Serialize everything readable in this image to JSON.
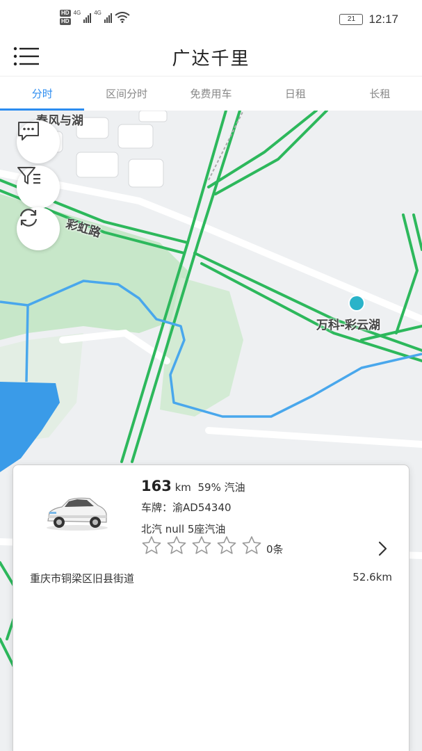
{
  "status_bar": {
    "hd1": "HD",
    "hd2": "HD",
    "net1": "4G",
    "net2": "4G",
    "battery": "21",
    "time": "12:17"
  },
  "header": {
    "title": "广达千里",
    "menu_icon": "hamburger-menu-icon"
  },
  "tabs": [
    {
      "label": "分时",
      "active": true
    },
    {
      "label": "区间分时",
      "active": false
    },
    {
      "label": "免费用车",
      "active": false
    },
    {
      "label": "日租",
      "active": false
    },
    {
      "label": "长租",
      "active": false
    }
  ],
  "map": {
    "labels": {
      "spring": "春风与湖",
      "rainbow_road": "彩虹路",
      "vanke": "万科-彩云湖"
    },
    "buttons": [
      "message-icon",
      "filter-icon",
      "refresh-icon"
    ],
    "colors": {
      "road": "#2db85c",
      "water": "#3a9be8",
      "park": "#c6e6c8",
      "route": "#49a7ec"
    }
  },
  "vehicle": {
    "range_value": "163",
    "range_unit": "km",
    "fuel_percent": "59%",
    "fuel_type": "汽油",
    "plate_label": "车牌：",
    "plate": "渝AD54340",
    "model": "北汽 null 5座汽油",
    "rating": 0,
    "reviews": "0条",
    "address": "重庆市铜梁区旧县街道",
    "distance": "52.6km"
  }
}
